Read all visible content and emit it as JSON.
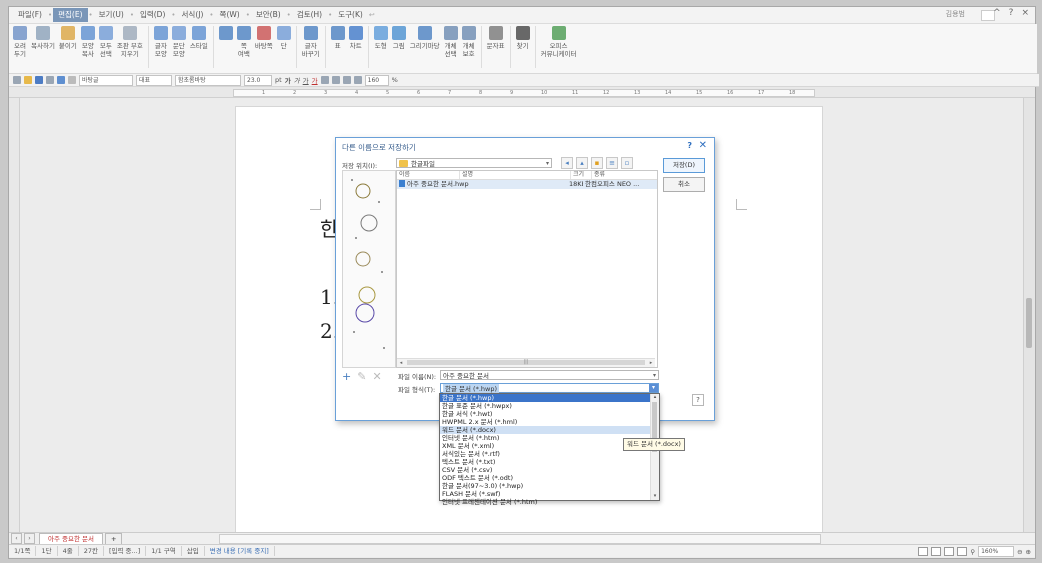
{
  "menubar": {
    "items": [
      "파일(F)",
      "편집(E)",
      "보기(U)",
      "입력(D)",
      "서식(J)",
      "쪽(W)",
      "보안(B)",
      "검토(H)",
      "도구(K)"
    ],
    "active_index": 1,
    "user": "김용범"
  },
  "ribbon": {
    "buttons": [
      {
        "label": "오려\n두기",
        "icon": "scissors-icon"
      },
      {
        "label": "복사하기",
        "icon": "copy-icon"
      },
      {
        "label": "붙이기",
        "icon": "paste-icon"
      },
      {
        "label": "모양\n복사",
        "icon": "format-painter-icon"
      },
      {
        "label": "모두\n선택",
        "icon": "select-all-icon"
      },
      {
        "label": "조판 부호\n지우기",
        "icon": "clear-codes-icon"
      },
      {
        "label": "글자\n모양",
        "icon": "char-shape-icon"
      },
      {
        "label": "문단\n모양",
        "icon": "para-shape-icon"
      },
      {
        "label": "스타일",
        "icon": "style-icon"
      },
      {
        "label": "",
        "icon": "page-layout-icon"
      },
      {
        "label": "쪽\n여백",
        "icon": "margin-icon"
      },
      {
        "label": "바탕쪽",
        "icon": "master-page-icon"
      },
      {
        "label": "단",
        "icon": "columns-icon"
      },
      {
        "label": "글자\n바꾸기",
        "icon": "replace-char-icon"
      },
      {
        "label": "표",
        "icon": "table-icon"
      },
      {
        "label": "차트",
        "icon": "chart-icon"
      },
      {
        "label": "도형",
        "icon": "shape-icon"
      },
      {
        "label": "그림",
        "icon": "picture-icon"
      },
      {
        "label": "그리기마당",
        "icon": "clipart-icon"
      },
      {
        "label": "개체\n선택",
        "icon": "object-select-icon"
      },
      {
        "label": "개체\n보호",
        "icon": "object-protect-icon"
      },
      {
        "label": "문자표",
        "icon": "symbol-icon"
      },
      {
        "label": "찾기",
        "icon": "find-icon"
      },
      {
        "label": "오피스\n커뮤니케이터",
        "icon": "communicator-icon"
      }
    ]
  },
  "toolbar2": {
    "style": "바탕글",
    "lang": "대표",
    "font": "함초롬바탕",
    "size": "23.0",
    "unit": "pt",
    "zoom_value": "160",
    "zoom_unit": "%"
  },
  "ruler": {
    "ticks": [
      "1",
      "2",
      "3",
      "4",
      "5",
      "6",
      "7",
      "8",
      "9",
      "10",
      "11",
      "12",
      "13",
      "14",
      "15",
      "16",
      "17",
      "18"
    ]
  },
  "document": {
    "heading": "한",
    "list1": "1.",
    "list2": "2."
  },
  "dialog": {
    "title": "다른 이름으로 저장하기",
    "help": "?",
    "close": "✕",
    "location_label": "저장 위치(I):",
    "location_value": "한글파일",
    "save_button": "저장(D)",
    "cancel_button": "취소",
    "columns": [
      "이름",
      "설명",
      "크기",
      "종류"
    ],
    "files": [
      {
        "name": "아주 중요한 문서.hwp",
        "desc": "",
        "size": "18KB",
        "type": "한컴오피스 NEO ..."
      }
    ],
    "filename_label": "파일 이름(N):",
    "filename_value": "아주 중요한 문서",
    "filetype_label": "파일 형식(T):",
    "filetype_value": "한글 문서 (*.hwp)",
    "help_button": "?"
  },
  "filetype_options": [
    "한글 문서 (*.hwp)",
    "한글 표준 문서 (*.hwpx)",
    "한글 서식 (*.hwt)",
    "HWPML 2.x 문서 (*.hml)",
    "워드 문서 (*.docx)",
    "인터넷 문서 (*.htm)",
    "XML 문서 (*.xml)",
    "서식있는 문서 (*.rtf)",
    "텍스트 문서 (*.txt)",
    "CSV 문서 (*.csv)",
    "ODF 텍스트 문서 (*.odt)",
    "한글 문서(97~3.0) (*.hwp)",
    "FLASH 문서 (*.swf)",
    "인터넷 프레젠테이션 문서 (*.htm)"
  ],
  "selected_option_index": 0,
  "hover_option_index": 4,
  "tooltip": "워드 문서 (*.docx)",
  "tabbar": {
    "doc_tab": "아주 중요한 문서",
    "add": "+"
  },
  "statusbar": {
    "items": [
      "1/1쪽",
      "1단",
      "4줄",
      "27칸",
      "[입력 중...]",
      "1/1 구역",
      "삽입"
    ],
    "track": "변경 내용 [기록 중지]",
    "zoom": "160%"
  },
  "colors": {
    "accent": "#3b74c9",
    "active_menu": "#7a96b8",
    "dialog_border": "#6aa0d8"
  }
}
